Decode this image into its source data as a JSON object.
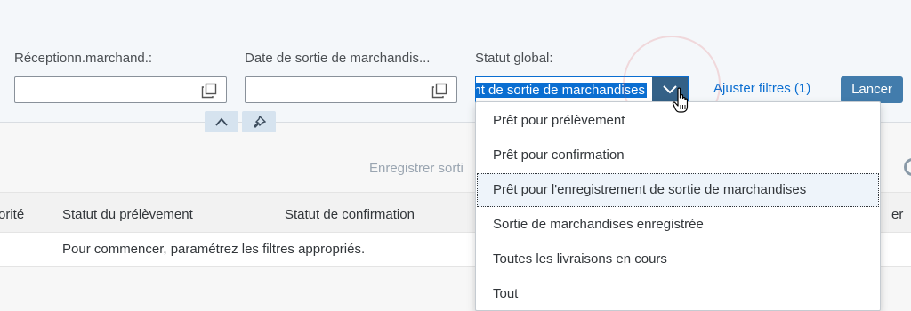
{
  "filters": {
    "goods_receipt": {
      "label": "Réceptionn.marchand.:",
      "value": ""
    },
    "goods_issue_date": {
      "label": "Date de sortie de marchandis...",
      "value": ""
    },
    "overall_status": {
      "label": "Statut global:",
      "value": "Prêt pour l'enregistrement de sortie de marchandises"
    },
    "adapt_filters": "Ajuster filtres (1)",
    "go": "Lancer"
  },
  "toolbar": {
    "post_goods_issue": "Enregistrer sorti"
  },
  "table": {
    "columns": [
      "orité",
      "Statut du prélèvement",
      "Statut de confirmation",
      "er"
    ],
    "empty_message": "Pour commencer, paramétrez les filtres appropriés."
  },
  "dropdown": {
    "options": [
      "Prêt pour prélèvement",
      "Prêt pour confirmation",
      "Prêt pour l'enregistrement de sortie de marchandises",
      "Sortie de marchandises enregistrée",
      "Toutes les livraisons en cours",
      "Tout"
    ],
    "focused_index": 2
  },
  "icons": {
    "value_help": "value-help-icon",
    "status_arrow": "chevron-down-icon",
    "collapse": "chevron-up-icon",
    "pin": "pin-icon",
    "settings": "gear-icon",
    "cursor": "hand-cursor-icon"
  },
  "colors": {
    "accent": "#0a6ed1",
    "arrow_button": "#346187",
    "go_button": "#427cac",
    "filter_bg": "#f4f7fa"
  }
}
